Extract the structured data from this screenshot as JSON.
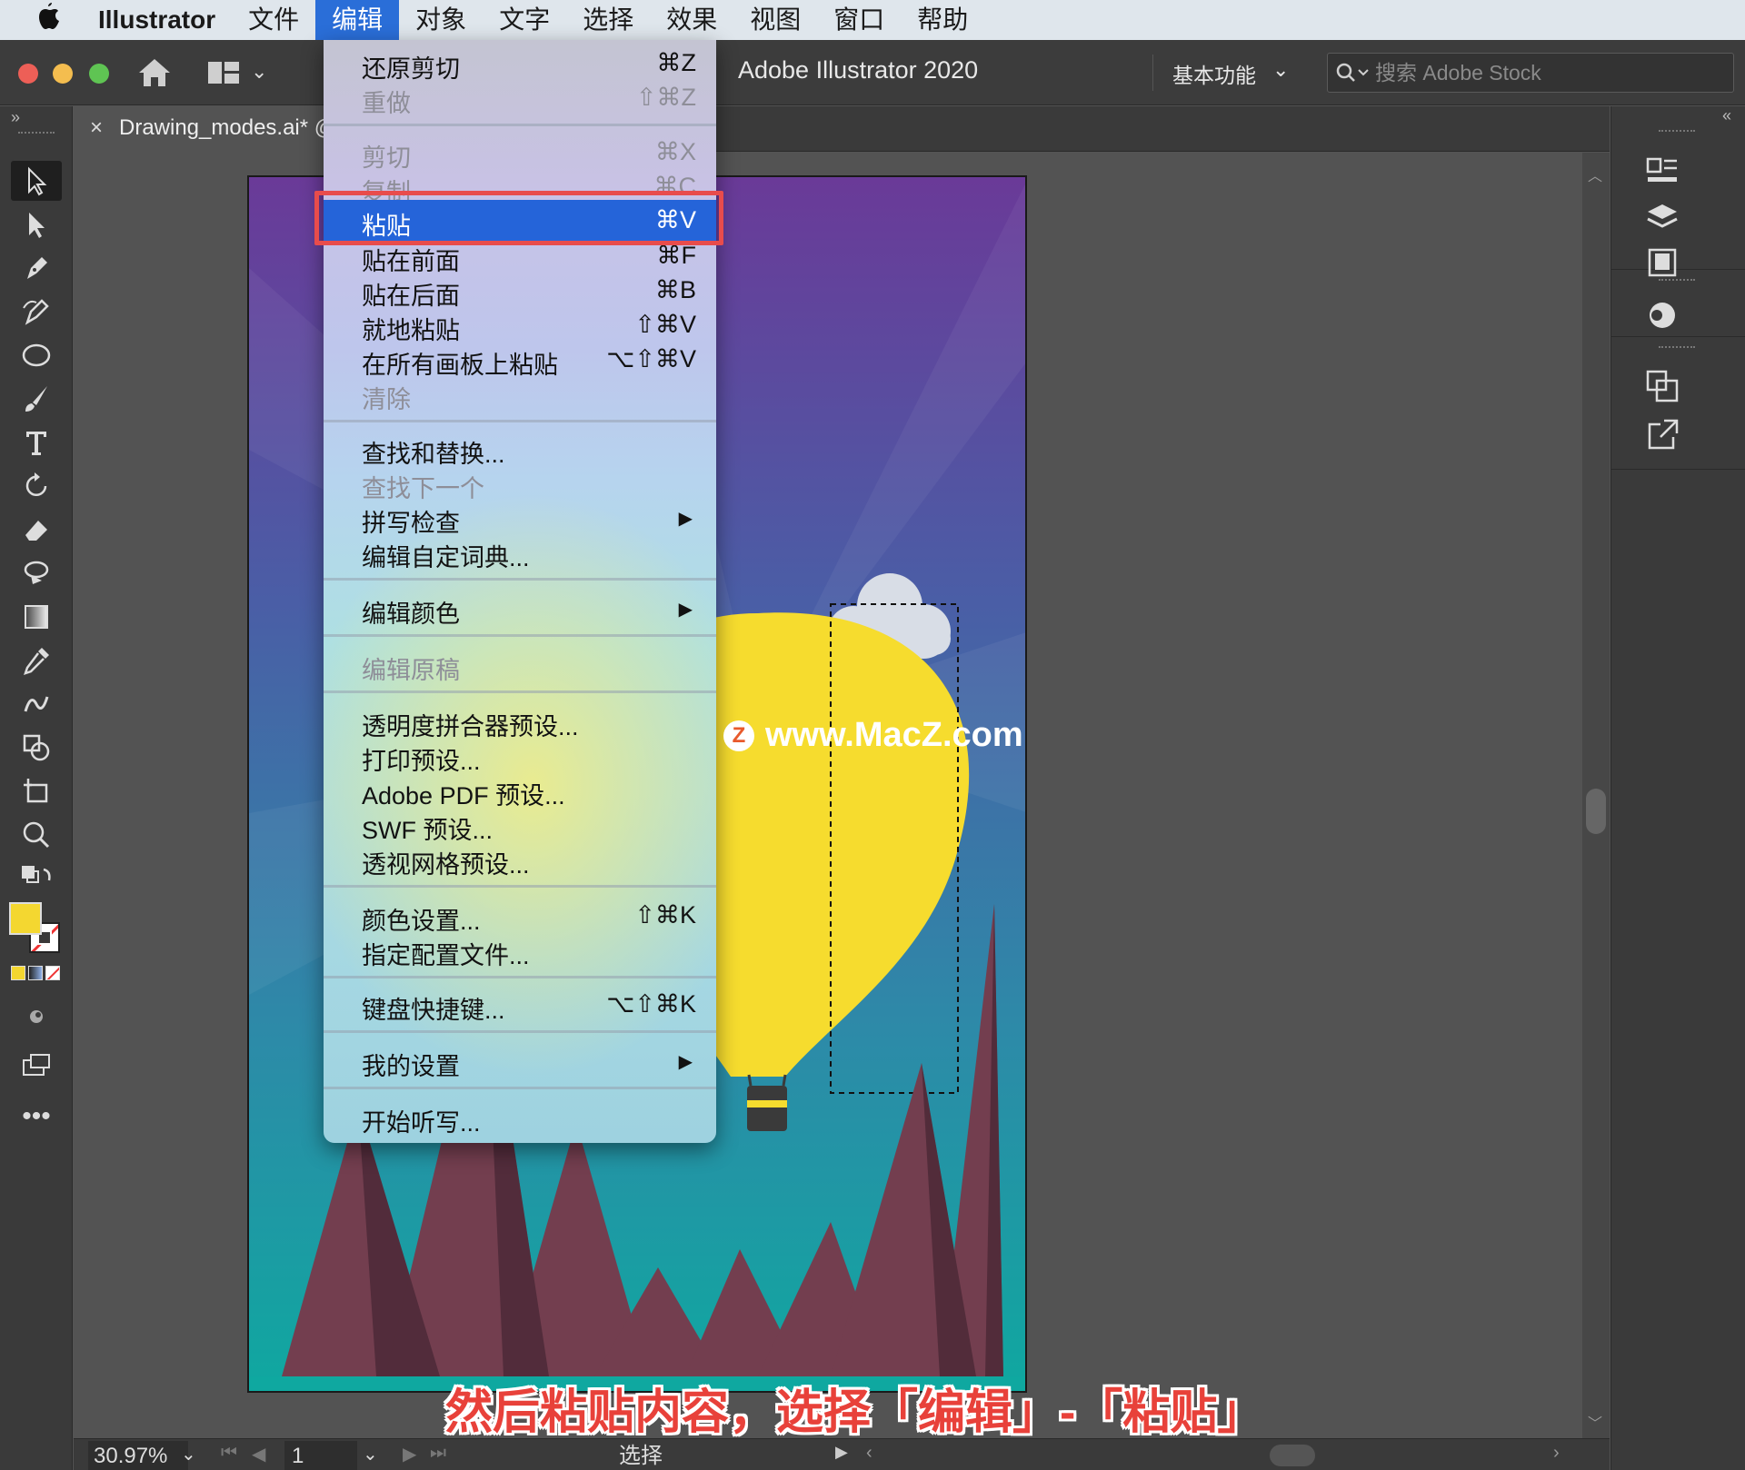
{
  "menubar": {
    "app_name": "Illustrator",
    "menus": [
      "文件",
      "编辑",
      "对象",
      "文字",
      "选择",
      "效果",
      "视图",
      "窗口",
      "帮助"
    ],
    "active_menu": "编辑"
  },
  "appbar": {
    "title": "Adobe Illustrator 2020",
    "workspace": "基本功能",
    "stock_search_placeholder": "搜索 Adobe Stock"
  },
  "document": {
    "tab_name": "Drawing_modes.ai* @"
  },
  "edit_menu": {
    "items": [
      {
        "label": "还原剪切",
        "shortcut": "⌘Z",
        "enabled": true
      },
      {
        "label": "重做",
        "shortcut": "⇧⌘Z",
        "enabled": false
      },
      {
        "label": "剪切",
        "shortcut": "⌘X",
        "enabled": false
      },
      {
        "label": "复制",
        "shortcut": "⌘C",
        "enabled": false
      },
      {
        "label": "粘贴",
        "shortcut": "⌘V",
        "enabled": true,
        "highlighted": true
      },
      {
        "label": "贴在前面",
        "shortcut": "⌘F",
        "enabled": true
      },
      {
        "label": "贴在后面",
        "shortcut": "⌘B",
        "enabled": true
      },
      {
        "label": "就地粘贴",
        "shortcut": "⇧⌘V",
        "enabled": true
      },
      {
        "label": "在所有画板上粘贴",
        "shortcut": "⌥⇧⌘V",
        "enabled": true
      },
      {
        "label": "清除",
        "shortcut": "",
        "enabled": false
      },
      {
        "label": "查找和替换...",
        "shortcut": "",
        "enabled": true
      },
      {
        "label": "查找下一个",
        "shortcut": "",
        "enabled": false
      },
      {
        "label": "拼写检查",
        "shortcut": "▶",
        "enabled": true
      },
      {
        "label": "编辑自定词典...",
        "shortcut": "",
        "enabled": true
      },
      {
        "label": "编辑颜色",
        "shortcut": "▶",
        "enabled": true
      },
      {
        "label": "编辑原稿",
        "shortcut": "",
        "enabled": false
      },
      {
        "label": "透明度拼合器预设...",
        "shortcut": "",
        "enabled": true
      },
      {
        "label": "打印预设...",
        "shortcut": "",
        "enabled": true
      },
      {
        "label": "Adobe PDF 预设...",
        "shortcut": "",
        "enabled": true
      },
      {
        "label": "SWF 预设...",
        "shortcut": "",
        "enabled": true
      },
      {
        "label": "透视网格预设...",
        "shortcut": "",
        "enabled": true
      },
      {
        "label": "颜色设置...",
        "shortcut": "⇧⌘K",
        "enabled": true
      },
      {
        "label": "指定配置文件...",
        "shortcut": "",
        "enabled": true
      },
      {
        "label": "键盘快捷键...",
        "shortcut": "⌥⇧⌘K",
        "enabled": true
      },
      {
        "label": "我的设置",
        "shortcut": "▶",
        "enabled": true
      },
      {
        "label": "开始听写...",
        "shortcut": "",
        "enabled": true
      }
    ]
  },
  "statusbar": {
    "zoom": "30.97%",
    "page": "1",
    "tool": "选择"
  },
  "watermark": "www.MacZ.com",
  "watermark_badge": "Z",
  "caption": "然后粘贴内容，选择「编辑」-「粘贴」",
  "colors": {
    "menu_highlight": "#2564d9",
    "callout_border": "#e84c4c",
    "fill_swatch": "#f4d730",
    "balloon": "#f6dc2e"
  },
  "icons": [
    "apple-icon",
    "home-icon",
    "layout-icon",
    "search-icon",
    "selection-tool-icon",
    "direct-selection-icon",
    "pen-icon",
    "curvature-icon",
    "ellipse-icon",
    "paintbrush-icon",
    "type-icon",
    "rotate-icon",
    "eraser-icon",
    "lasso-icon",
    "gradient-icon",
    "eyedropper-icon",
    "blend-icon",
    "shape-builder-icon",
    "artboard-icon",
    "zoom-icon",
    "properties-icon",
    "layers-icon",
    "libraries-icon",
    "color-icon",
    "transform-icon",
    "export-icon"
  ]
}
